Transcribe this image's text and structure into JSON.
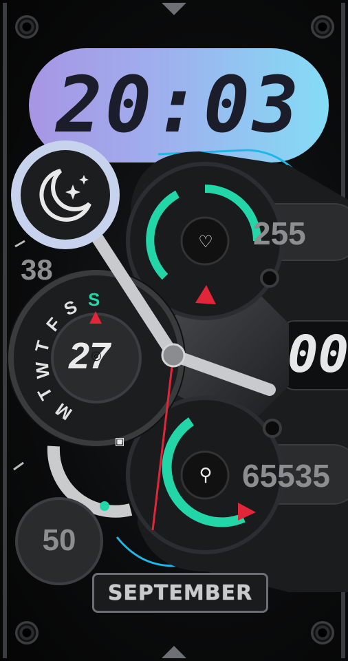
{
  "watch": {
    "digital_time": "20:03",
    "heart_rate": "255",
    "steps": "65535",
    "seconds": "00",
    "day_of_month": "27",
    "battery_small": "38",
    "bottom_dial": "50",
    "month": "SEPTEMBER",
    "weekdays": [
      "S",
      "S",
      "F",
      "T",
      "W",
      "T",
      "M"
    ],
    "active_weekday_index": 0
  },
  "colors": {
    "accent_green": "#22d6a8",
    "hand_red": "#e2263a",
    "lcd_left": "#a795e4",
    "lcd_right": "#84dcf5",
    "bezel_blue": "#1fb8e6"
  },
  "icons": {
    "night_mode": "moon-stars-icon",
    "heart_rate": "heart-rate-icon",
    "steps": "steps-walker-icon",
    "location": "target-icon"
  }
}
